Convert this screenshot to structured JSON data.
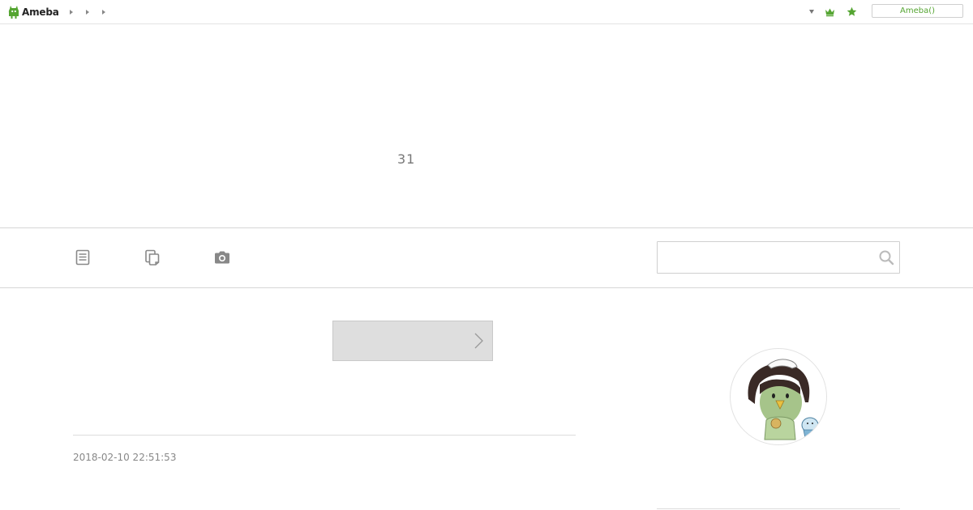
{
  "topbar": {
    "logo_text": "Ameba",
    "ameba_button_label": "Ameba()",
    "accent_color": "#55a532"
  },
  "header": {
    "title": "31"
  },
  "nav": {
    "items": [
      {
        "icon": "entry-list-icon"
      },
      {
        "icon": "theme-list-icon"
      },
      {
        "icon": "camera-icon"
      }
    ],
    "search": {
      "placeholder": "",
      "value": ""
    }
  },
  "main": {
    "pager_label": "",
    "entry_date": "2018-02-10 22:51:53"
  }
}
